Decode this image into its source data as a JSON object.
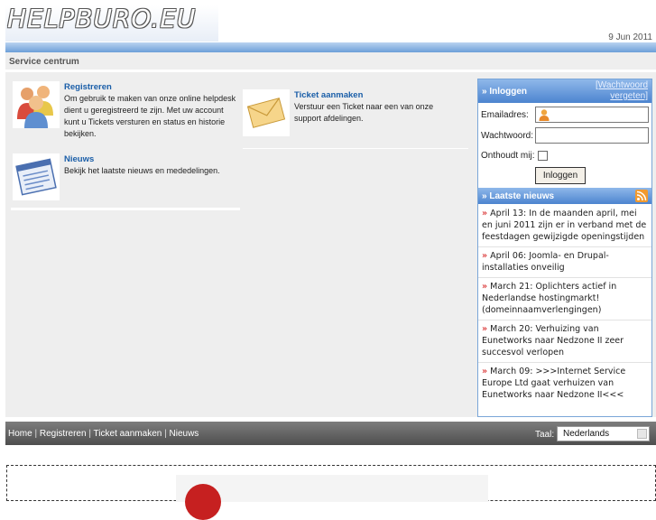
{
  "header": {
    "logo_text": "HELPBURO.EU",
    "date": "9 Jun 2011"
  },
  "page": {
    "title": "Service centrum"
  },
  "services": [
    {
      "title": "Registreren",
      "description": "Om gebruik te maken van onze online helpdesk dient u geregistreerd te zijn. Met uw account kunt u Tickets versturen en status en historie bekijken.",
      "icon": "users-icon"
    },
    {
      "title": "Ticket aanmaken",
      "description": "Verstuur een Ticket naar een van onze support afdelingen.",
      "icon": "envelope-icon"
    },
    {
      "title": "Nieuws",
      "description": "Bekijk het laatste nieuws en mededelingen.",
      "icon": "news-window-icon"
    }
  ],
  "login": {
    "heading": "Inloggen",
    "forgot_link": "[Wachtwoord vergeten]",
    "email_label": "Emailadres:",
    "password_label": "Wachtwoord:",
    "remember_label": "Onthoudt mij:",
    "submit_label": "Inloggen"
  },
  "news": {
    "heading": "Laatste nieuws",
    "items": [
      "April 13: In de maanden april, mei en juni 2011 zijn er in verband met de feestdagen gewijzigde openingstijden",
      "April 06: Joomla- en Drupal-installaties onveilig",
      "March 21: Oplichters actief in Nederlandse hostingmarkt! (domeinnaamverlengingen)",
      "March 20: Verhuizing van Eunetworks naar Nedzone II zeer succesvol verlopen",
      "March 09: >>>Internet Service Europe Ltd gaat verhuizen van Eunetworks naar Nedzone II<<<"
    ]
  },
  "footer": {
    "links": [
      "Home",
      "Registreren",
      "Ticket aanmaken",
      "Nieuws"
    ],
    "language_label": "Taal:",
    "language_value": "Nederlands"
  },
  "colors": {
    "accent_blue": "#4c84cf",
    "link_blue": "#1a5ea8",
    "footer_gray": "#5e5e5e"
  }
}
